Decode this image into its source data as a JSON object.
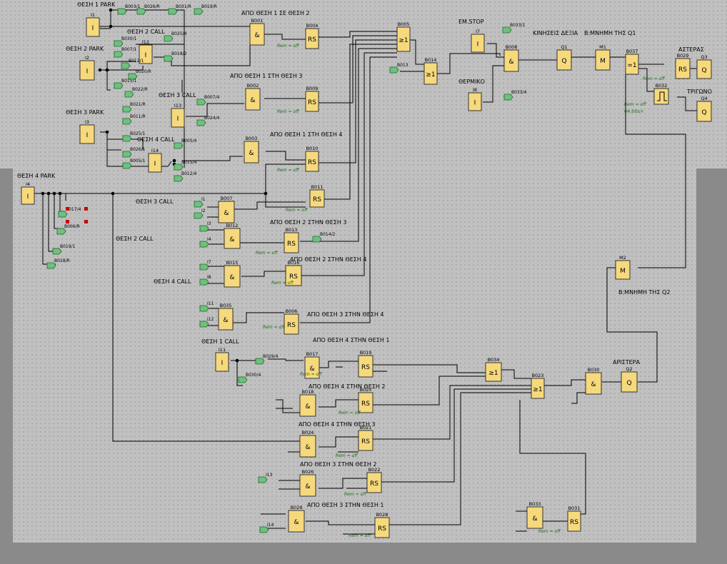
{
  "colors": {
    "block_fill": "#f6d97c",
    "block_stroke": "#333333",
    "wire": "#000000",
    "flag_fill": "#6fbf7f",
    "flag_stroke": "#1e6b2e",
    "param_text": "#1a6b1a",
    "marker": "#cc0000",
    "sheet": "#c0c0c0",
    "outside": "#8a8a8a"
  },
  "labels": {
    "title_pos1_park": "ΘΕΣΗ 1 PARK",
    "title_pos2_call": "ΘΕΣΗ 2 CALL",
    "title_pos2_park": "ΘΕΣΗ 2 PARK",
    "title_pos3_call_top": "ΘΕΣΗ 3 CALL",
    "title_pos3_park": "ΘΕΣΗ 3 PARK",
    "title_pos4_call_top": "ΘΕΣΗ 4 CALL",
    "title_pos4_park": "ΘΕΣΗ 4 PARK",
    "title_pos3_call": "ΘΕΣΗ 3 CALL",
    "title_pos2_call_low": "ΘΕΣΗ 2 CALL",
    "title_pos4_call": "ΘΕΣΗ 4 CALL",
    "title_pos1_call": "ΘΕΣΗ 1 CALL",
    "route_1_2": "ΑΠΟ ΘΕΣΗ 1 ΣΕ ΘΕΣΗ 2",
    "route_1_3": "ΑΠΟ ΘΕΣΗ 1 ΣΤΗ ΘΕΣΗ 3",
    "route_1_4": "ΑΠΟ ΘΕΣΗ 1 ΣΤΗ ΘΕΣΗ 4",
    "route_2_3": "ΑΠΟ  ΘΕΣΗ 2  ΣΤΗΝ ΘΕΣΗ 3",
    "route_2_4": "ΑΠΟ ΘΕΣΗ 2 ΣΤΗΝ ΘΕΣΗ 4",
    "route_3_4": "ΑΠΟ ΘΕΣΗ 3 ΣΤΗΝ ΘΕΣΗ 4",
    "route_4_1": "ΑΠΟ ΘΕΣΗ 4 ΣΤΗΝ ΘΕΣΗ 1",
    "route_4_2": "ΑΠΟ ΘΕΣΗ 4 ΣΤΗΝ ΘΕΣΗ 2",
    "route_4_3": "ΑΠΟ ΘΕΣΗ 4 ΣΤΗΝ ΘΕΣΗ 3",
    "route_3_2": "ΑΠΟ ΘΕΣΗ 3 ΣΤΗΝ ΘΕΣΗ 2",
    "route_3_1": "ΑΠΟ ΘΕΣΗ 3 ΣΤΗΝ ΘΕΣΗ 1",
    "em_stop": "ΕΜ.STOP",
    "thermal": "ΘΕΡΜΙΚΟ",
    "move_right": "ΚΙΝΗΣΕΙΣ ΔΕΞΙΑ",
    "memory_q1": "Β:ΜΝΗΜΗ ΤΗΣ Q1",
    "memory_q2": "Β:ΜΝΗΜΗ ΤΗΣ Q2",
    "star": "ΑΣΤΕΡΑΣ",
    "delta": "ΤΡΙΓΩΝΟ",
    "left": "ΑΡΙΣΤΕΡΑ"
  },
  "blocks": {
    "I1": {
      "name": "I1",
      "sym": "I"
    },
    "I12": {
      "name": "I12",
      "sym": "I"
    },
    "I2": {
      "name": "I2",
      "sym": "I"
    },
    "I13": {
      "name": "I13",
      "sym": "I"
    },
    "I3": {
      "name": "I3",
      "sym": "I"
    },
    "I14": {
      "name": "I14",
      "sym": "I"
    },
    "I4": {
      "name": "I4",
      "sym": "I"
    },
    "I11": {
      "name": "I11",
      "sym": "I"
    },
    "I7": {
      "name": "I7",
      "sym": "I"
    },
    "I8": {
      "name": "I8",
      "sym": "I"
    },
    "B001": {
      "name": "B001",
      "sym": "&"
    },
    "B004": {
      "name": "B004",
      "sym": "RS"
    },
    "B002": {
      "name": "B002",
      "sym": "&"
    },
    "B009": {
      "name": "B009",
      "sym": "RS"
    },
    "B003": {
      "name": "B003",
      "sym": "&"
    },
    "B010": {
      "name": "B010",
      "sym": "RS"
    },
    "B005": {
      "name": "B005",
      "sym": "≥1"
    },
    "B014": {
      "name": "B014",
      "sym": "≥1"
    },
    "B011": {
      "name": "B011",
      "sym": "RS"
    },
    "B007": {
      "name": "B007",
      "sym": "&"
    },
    "B012": {
      "name": "B012",
      "sym": "&"
    },
    "B013": {
      "name": "B013",
      "sym": "RS"
    },
    "B015": {
      "name": "B015",
      "sym": "&"
    },
    "B016": {
      "name": "B016",
      "sym": "RS"
    },
    "B035": {
      "name": "B035",
      "sym": "&"
    },
    "B006": {
      "name": "B006",
      "sym": "RS"
    },
    "B008": {
      "name": "B008",
      "sym": "&"
    },
    "Q1": {
      "name": "Q1",
      "sym": "Q"
    },
    "M1": {
      "name": "M1",
      "sym": "M"
    },
    "B037": {
      "name": "B037",
      "sym": "=1"
    },
    "B029": {
      "name": "B029",
      "sym": "RS"
    },
    "Q3": {
      "name": "Q3",
      "sym": "Q"
    },
    "B032": {
      "name": "B032",
      "sym": ""
    },
    "Q4": {
      "name": "Q4",
      "sym": "Q"
    },
    "M2": {
      "name": "M2",
      "sym": "M"
    },
    "B017": {
      "name": "B017",
      "sym": "&"
    },
    "B019": {
      "name": "B019",
      "sym": "RS"
    },
    "B018": {
      "name": "B018",
      "sym": "&"
    },
    "B020": {
      "name": "B020",
      "sym": "RS"
    },
    "B024": {
      "name": "B024",
      "sym": "&"
    },
    "B021": {
      "name": "B021",
      "sym": "RS"
    },
    "B026": {
      "name": "B026",
      "sym": "&"
    },
    "B022": {
      "name": "B022",
      "sym": "RS"
    },
    "B028": {
      "name": "B028",
      "sym": "&"
    },
    "B028b": {
      "name": "B028",
      "sym": "RS"
    },
    "B034": {
      "name": "B034",
      "sym": "≥1"
    },
    "B023": {
      "name": "B023",
      "sym": "≥1"
    },
    "B030": {
      "name": "B030",
      "sym": "&"
    },
    "Q2": {
      "name": "Q2",
      "sym": "Q"
    },
    "B033": {
      "name": "B033",
      "sym": "&"
    },
    "B031": {
      "name": "B031",
      "sym": "RS"
    }
  },
  "params": {
    "rem_off": "Rem = off",
    "timer": "04:00s+"
  },
  "flags": [
    "B003/1",
    "B026/R",
    "B031/R",
    "B019/R",
    "B030/1",
    "B007/1",
    "B012/1",
    "B020/R",
    "B015/1",
    "B022/R",
    "B021/R",
    "B011/R",
    "B025/1",
    "B026/1",
    "B005/1",
    "B025/4",
    "B018/2",
    "B007/4",
    "B024/4",
    "B005/4",
    "B015/4",
    "B012/4",
    "B017/4",
    "B006/R",
    "B019/1",
    "B018/R",
    "B014/2",
    "B013",
    "B033/1",
    "B033/4",
    "B029/4",
    "B030/4",
    "I1",
    "I2",
    "I3",
    "I4",
    "I7",
    "I8",
    "I11",
    "I12",
    "I13",
    "I14"
  ]
}
